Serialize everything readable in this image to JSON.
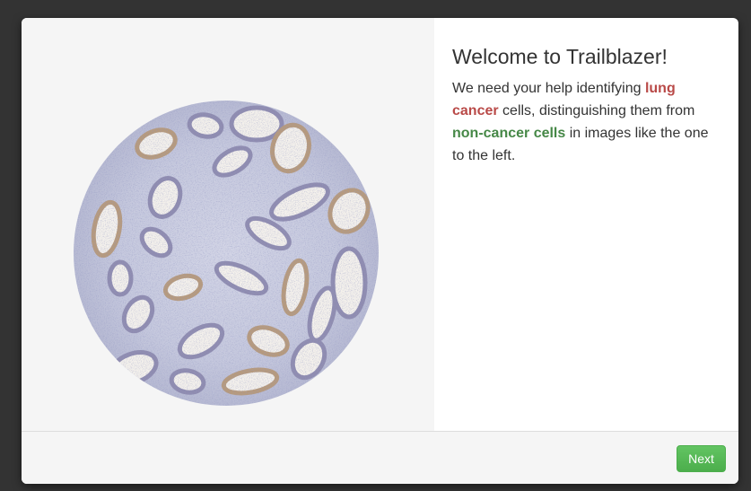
{
  "colors": {
    "backdrop": "#333333",
    "cancer_text": "#b94a48",
    "non_cancer_text": "#468847",
    "button": "#5cb85c"
  },
  "welcome": {
    "title": "Welcome to Trailblazer!",
    "intro_part1": "We need your help identifying ",
    "cancer_label": "lung cancer",
    "intro_part2": " cells, distinguishing them from ",
    "non_cancer_label": "non-cancer cells",
    "intro_part3": " in images like the one to the left."
  },
  "footer": {
    "next_label": "Next"
  }
}
